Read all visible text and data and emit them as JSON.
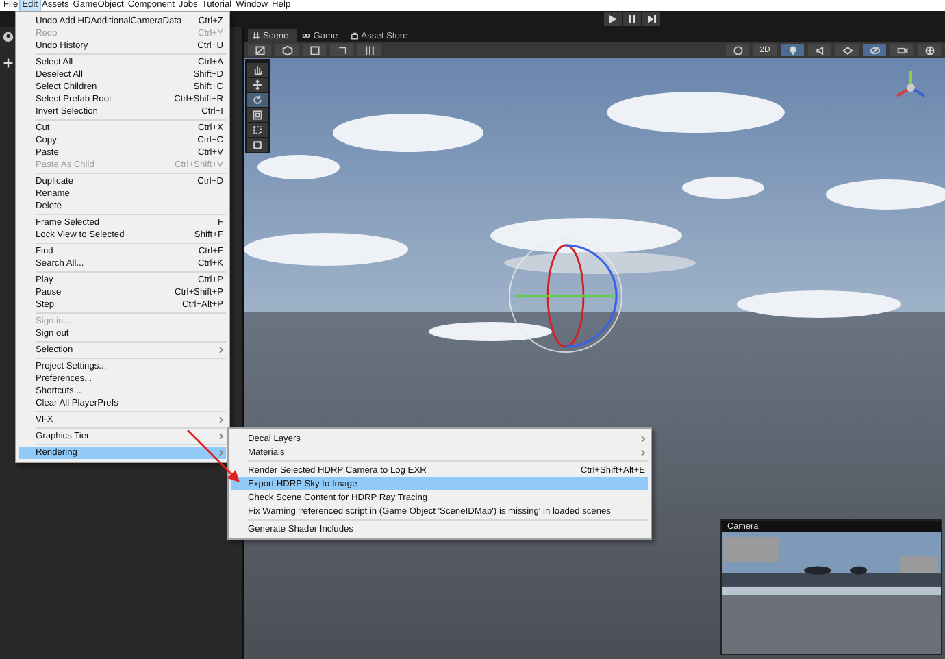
{
  "menubar": [
    {
      "label": "File",
      "selected": false
    },
    {
      "label": "Edit",
      "selected": true
    },
    {
      "label": "Assets",
      "selected": false
    },
    {
      "label": "GameObject",
      "selected": false
    },
    {
      "label": "Component",
      "selected": false
    },
    {
      "label": "Jobs",
      "selected": false
    },
    {
      "label": "Tutorial",
      "selected": false
    },
    {
      "label": "Window",
      "selected": false
    },
    {
      "label": "Help",
      "selected": false
    }
  ],
  "edit_menu": [
    {
      "kind": "item",
      "label": "Undo Add HDAdditionalCameraData",
      "shortcut": "Ctrl+Z",
      "disabled": false,
      "submenu": false,
      "selected": false
    },
    {
      "kind": "item",
      "label": "Redo",
      "shortcut": "Ctrl+Y",
      "disabled": true,
      "submenu": false,
      "selected": false
    },
    {
      "kind": "item",
      "label": "Undo History",
      "shortcut": "Ctrl+U",
      "disabled": false,
      "submenu": false,
      "selected": false
    },
    {
      "kind": "separator"
    },
    {
      "kind": "item",
      "label": "Select All",
      "shortcut": "Ctrl+A",
      "disabled": false,
      "submenu": false,
      "selected": false
    },
    {
      "kind": "item",
      "label": "Deselect All",
      "shortcut": "Shift+D",
      "disabled": false,
      "submenu": false,
      "selected": false
    },
    {
      "kind": "item",
      "label": "Select Children",
      "shortcut": "Shift+C",
      "disabled": false,
      "submenu": false,
      "selected": false
    },
    {
      "kind": "item",
      "label": "Select Prefab Root",
      "shortcut": "Ctrl+Shift+R",
      "disabled": false,
      "submenu": false,
      "selected": false
    },
    {
      "kind": "item",
      "label": "Invert Selection",
      "shortcut": "Ctrl+I",
      "disabled": false,
      "submenu": false,
      "selected": false
    },
    {
      "kind": "separator"
    },
    {
      "kind": "item",
      "label": "Cut",
      "shortcut": "Ctrl+X",
      "disabled": false,
      "submenu": false,
      "selected": false
    },
    {
      "kind": "item",
      "label": "Copy",
      "shortcut": "Ctrl+C",
      "disabled": false,
      "submenu": false,
      "selected": false
    },
    {
      "kind": "item",
      "label": "Paste",
      "shortcut": "Ctrl+V",
      "disabled": false,
      "submenu": false,
      "selected": false
    },
    {
      "kind": "item",
      "label": "Paste As Child",
      "shortcut": "Ctrl+Shift+V",
      "disabled": true,
      "submenu": false,
      "selected": false
    },
    {
      "kind": "separator"
    },
    {
      "kind": "item",
      "label": "Duplicate",
      "shortcut": "Ctrl+D",
      "disabled": false,
      "submenu": false,
      "selected": false
    },
    {
      "kind": "item",
      "label": "Rename",
      "disabled": false,
      "submenu": false,
      "selected": false
    },
    {
      "kind": "item",
      "label": "Delete",
      "disabled": false,
      "submenu": false,
      "selected": false
    },
    {
      "kind": "separator"
    },
    {
      "kind": "item",
      "label": "Frame Selected",
      "shortcut": "F",
      "disabled": false,
      "submenu": false,
      "selected": false
    },
    {
      "kind": "item",
      "label": "Lock View to Selected",
      "shortcut": "Shift+F",
      "disabled": false,
      "submenu": false,
      "selected": false
    },
    {
      "kind": "separator"
    },
    {
      "kind": "item",
      "label": "Find",
      "shortcut": "Ctrl+F",
      "disabled": false,
      "submenu": false,
      "selected": false
    },
    {
      "kind": "item",
      "label": "Search All...",
      "shortcut": "Ctrl+K",
      "disabled": false,
      "submenu": false,
      "selected": false
    },
    {
      "kind": "separator"
    },
    {
      "kind": "item",
      "label": "Play",
      "shortcut": "Ctrl+P",
      "disabled": false,
      "submenu": false,
      "selected": false
    },
    {
      "kind": "item",
      "label": "Pause",
      "shortcut": "Ctrl+Shift+P",
      "disabled": false,
      "submenu": false,
      "selected": false
    },
    {
      "kind": "item",
      "label": "Step",
      "shortcut": "Ctrl+Alt+P",
      "disabled": false,
      "submenu": false,
      "selected": false
    },
    {
      "kind": "separator"
    },
    {
      "kind": "item",
      "label": "Sign in...",
      "disabled": true,
      "submenu": false,
      "selected": false
    },
    {
      "kind": "item",
      "label": "Sign out",
      "disabled": false,
      "submenu": false,
      "selected": false
    },
    {
      "kind": "separator"
    },
    {
      "kind": "item",
      "label": "Selection",
      "disabled": false,
      "submenu": true,
      "selected": false
    },
    {
      "kind": "separator"
    },
    {
      "kind": "item",
      "label": "Project Settings...",
      "disabled": false,
      "submenu": false,
      "selected": false
    },
    {
      "kind": "item",
      "label": "Preferences...",
      "disabled": false,
      "submenu": false,
      "selected": false
    },
    {
      "kind": "item",
      "label": "Shortcuts...",
      "disabled": false,
      "submenu": false,
      "selected": false
    },
    {
      "kind": "item",
      "label": "Clear All PlayerPrefs",
      "disabled": false,
      "submenu": false,
      "selected": false
    },
    {
      "kind": "separator"
    },
    {
      "kind": "item",
      "label": "VFX",
      "disabled": false,
      "submenu": true,
      "selected": false
    },
    {
      "kind": "separator"
    },
    {
      "kind": "item",
      "label": "Graphics Tier",
      "disabled": false,
      "submenu": true,
      "selected": false
    },
    {
      "kind": "separator"
    },
    {
      "kind": "item",
      "label": "Rendering",
      "disabled": false,
      "submenu": true,
      "selected": true
    }
  ],
  "rendering_menu": [
    {
      "kind": "item",
      "label": "Decal Layers",
      "disabled": false,
      "submenu": true,
      "selected": false
    },
    {
      "kind": "item",
      "label": "Materials",
      "disabled": false,
      "submenu": true,
      "selected": false
    },
    {
      "kind": "separator"
    },
    {
      "kind": "item",
      "label": "Render Selected HDRP Camera to Log EXR",
      "shortcut": "Ctrl+Shift+Alt+E",
      "disabled": false,
      "submenu": false,
      "selected": false
    },
    {
      "kind": "item",
      "label": "Export HDRP Sky to Image",
      "disabled": false,
      "submenu": false,
      "selected": true
    },
    {
      "kind": "item",
      "label": "Check Scene Content for HDRP Ray Tracing",
      "disabled": false,
      "submenu": false,
      "selected": false
    },
    {
      "kind": "item",
      "label": "Fix Warning 'referenced script in (Game Object 'SceneIDMap') is missing' in loaded scenes",
      "disabled": false,
      "submenu": false,
      "selected": false
    },
    {
      "kind": "separator"
    },
    {
      "kind": "item",
      "label": "Generate Shader Includes",
      "disabled": false,
      "submenu": false,
      "selected": false
    }
  ],
  "scene_view": {
    "tabs": [
      {
        "label": "Scene",
        "kind": "scene",
        "selected": true
      },
      {
        "label": "Game",
        "kind": "game",
        "selected": false
      },
      {
        "label": "Asset Store",
        "kind": "store",
        "selected": false
      }
    ],
    "mode_2d": {
      "label": "2D",
      "selected": false
    },
    "tools": [
      {
        "kind": "hand",
        "selected": false
      },
      {
        "kind": "move",
        "selected": false
      },
      {
        "kind": "rotate",
        "selected": true
      },
      {
        "kind": "scale",
        "selected": false
      },
      {
        "kind": "rect",
        "selected": false
      },
      {
        "kind": "transform",
        "selected": false
      }
    ],
    "camera_preview": {
      "title": "Camera"
    }
  }
}
